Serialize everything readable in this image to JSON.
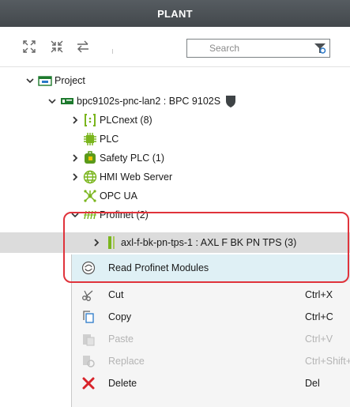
{
  "header": {
    "title": "PLANT"
  },
  "toolbar": {
    "search_placeholder": "Search",
    "icons": [
      "expand-all-icon",
      "collapse-all-icon",
      "sync-icon",
      "filter-icon"
    ]
  },
  "tree": {
    "project": "Project",
    "device": "bpc9102s-pnc-lan2 : BPC 9102S",
    "plcnext": "PLCnext (8)",
    "plc": "PLC",
    "safety_plc": "Safety PLC (1)",
    "hmi": "HMI Web Server",
    "opc": "OPC UA",
    "profinet": "Profinet (2)",
    "axl": "axl-f-bk-pn-tps-1 : AXL F BK PN TPS (3)"
  },
  "context_menu": {
    "items": [
      {
        "label": "Read Profinet Modules",
        "shortcut": "",
        "enabled": true,
        "highlighted": true,
        "icon": "read-profinet-icon"
      },
      {
        "label": "Cut",
        "shortcut": "Ctrl+X",
        "enabled": true,
        "icon": "scissors-icon"
      },
      {
        "label": "Copy",
        "shortcut": "Ctrl+C",
        "enabled": true,
        "icon": "copy-icon"
      },
      {
        "label": "Paste",
        "shortcut": "Ctrl+V",
        "enabled": false,
        "icon": "paste-icon"
      },
      {
        "label": "Replace",
        "shortcut": "Ctrl+Shift+R",
        "enabled": false,
        "icon": "replace-icon"
      },
      {
        "label": "Delete",
        "shortcut": "Del",
        "enabled": true,
        "icon": "delete-icon"
      }
    ]
  },
  "colors": {
    "header_bg": "#4b5055",
    "highlight_border": "#e0333b",
    "menu_highlight": "#dff0f5",
    "delete_red": "#d8232a",
    "plc_green": "#7ab51d"
  }
}
